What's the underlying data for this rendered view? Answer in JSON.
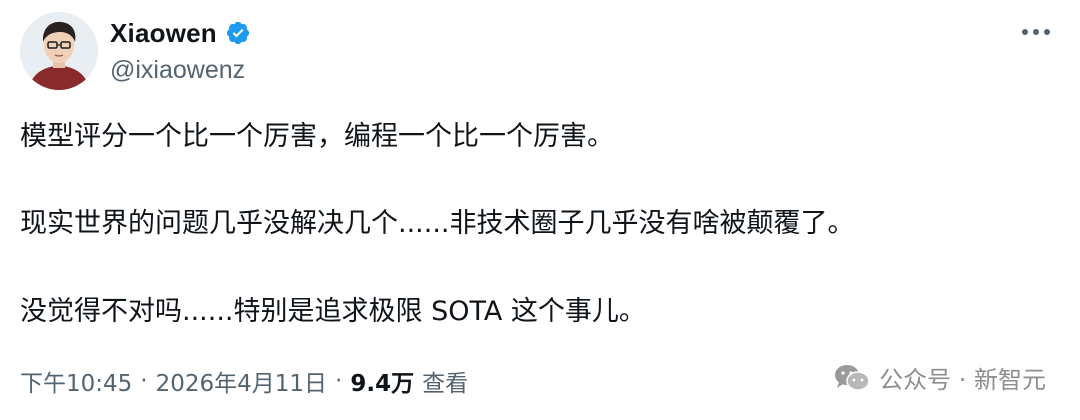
{
  "author": {
    "display_name": "Xiaowen",
    "handle": "@ixiaowenz",
    "verified": true
  },
  "tweet": {
    "lines": [
      "模型评分一个比一个厉害，编程一个比一个厉害。",
      "现实世界的问题几乎没解决几个......非技术圈子几乎没有啥被颠覆了。",
      "没觉得不对吗......特别是追求极限 SOTA 这个事儿。"
    ]
  },
  "meta": {
    "time": "下午10:45",
    "separator": "·",
    "date": "2026年4月11日",
    "views_count": "9.4万",
    "views_label": "查看"
  },
  "watermark": {
    "text": "公众号 · 新智元"
  },
  "colors": {
    "verified_blue": "#1d9bf0",
    "text_primary": "#0f1419",
    "text_secondary": "#536471"
  },
  "icons": {
    "verified": "verified-badge-icon",
    "more": "more-options-icon",
    "watermark": "wechat-logo-icon"
  }
}
